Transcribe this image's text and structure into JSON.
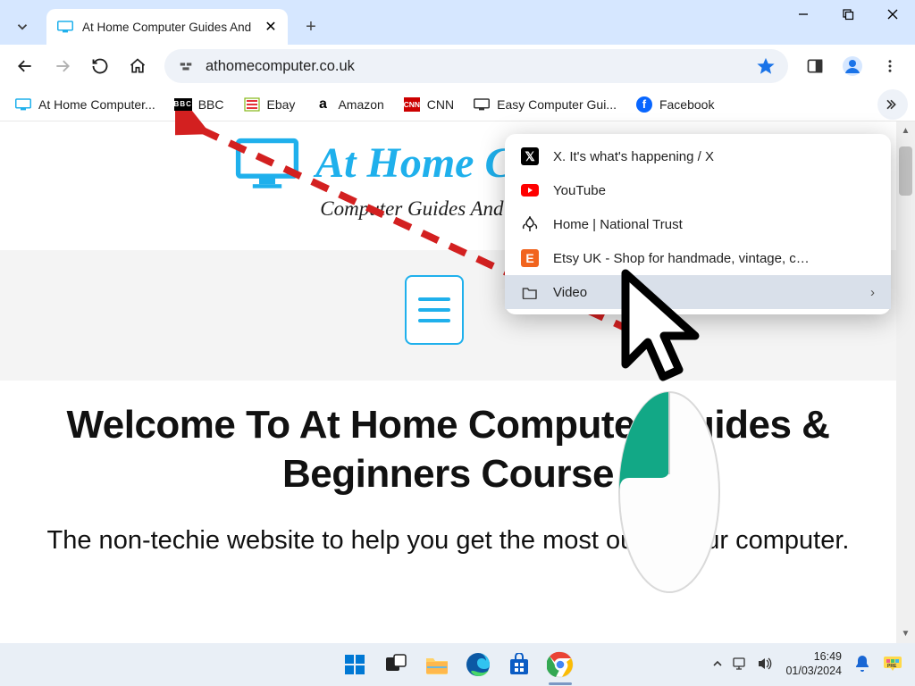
{
  "window": {
    "tab_title": "At Home Computer Guides And"
  },
  "toolbar": {
    "url": "athomecomputer.co.uk"
  },
  "bookmarks": [
    {
      "label": "At Home Computer...",
      "icon": "monitor"
    },
    {
      "label": "BBC",
      "icon": "bbc"
    },
    {
      "label": "Ebay",
      "icon": "ebay"
    },
    {
      "label": "Amazon",
      "icon": "amazon"
    },
    {
      "label": "CNN",
      "icon": "cnn"
    },
    {
      "label": "Easy Computer Gui...",
      "icon": "monitor-dark"
    },
    {
      "label": "Facebook",
      "icon": "fb"
    }
  ],
  "overflow_items": [
    {
      "label": "X. It's what's happening / X",
      "icon": "x"
    },
    {
      "label": "YouTube",
      "icon": "yt"
    },
    {
      "label": "Home | National Trust",
      "icon": "nt"
    },
    {
      "label": "Etsy UK - Shop for handmade, vintage, c…",
      "icon": "etsy"
    },
    {
      "label": "Video",
      "icon": "folder",
      "hover": true,
      "submenu": true
    }
  ],
  "page": {
    "site_title": "At Home Computer",
    "site_sub": "Computer Guides And Courses",
    "heading": "Welcome To At Home Computer Guides & Beginners Course",
    "subheading": "The non-techie website to help you get the most out of your computer."
  },
  "tray": {
    "time": "16:49",
    "date": "01/03/2024"
  }
}
